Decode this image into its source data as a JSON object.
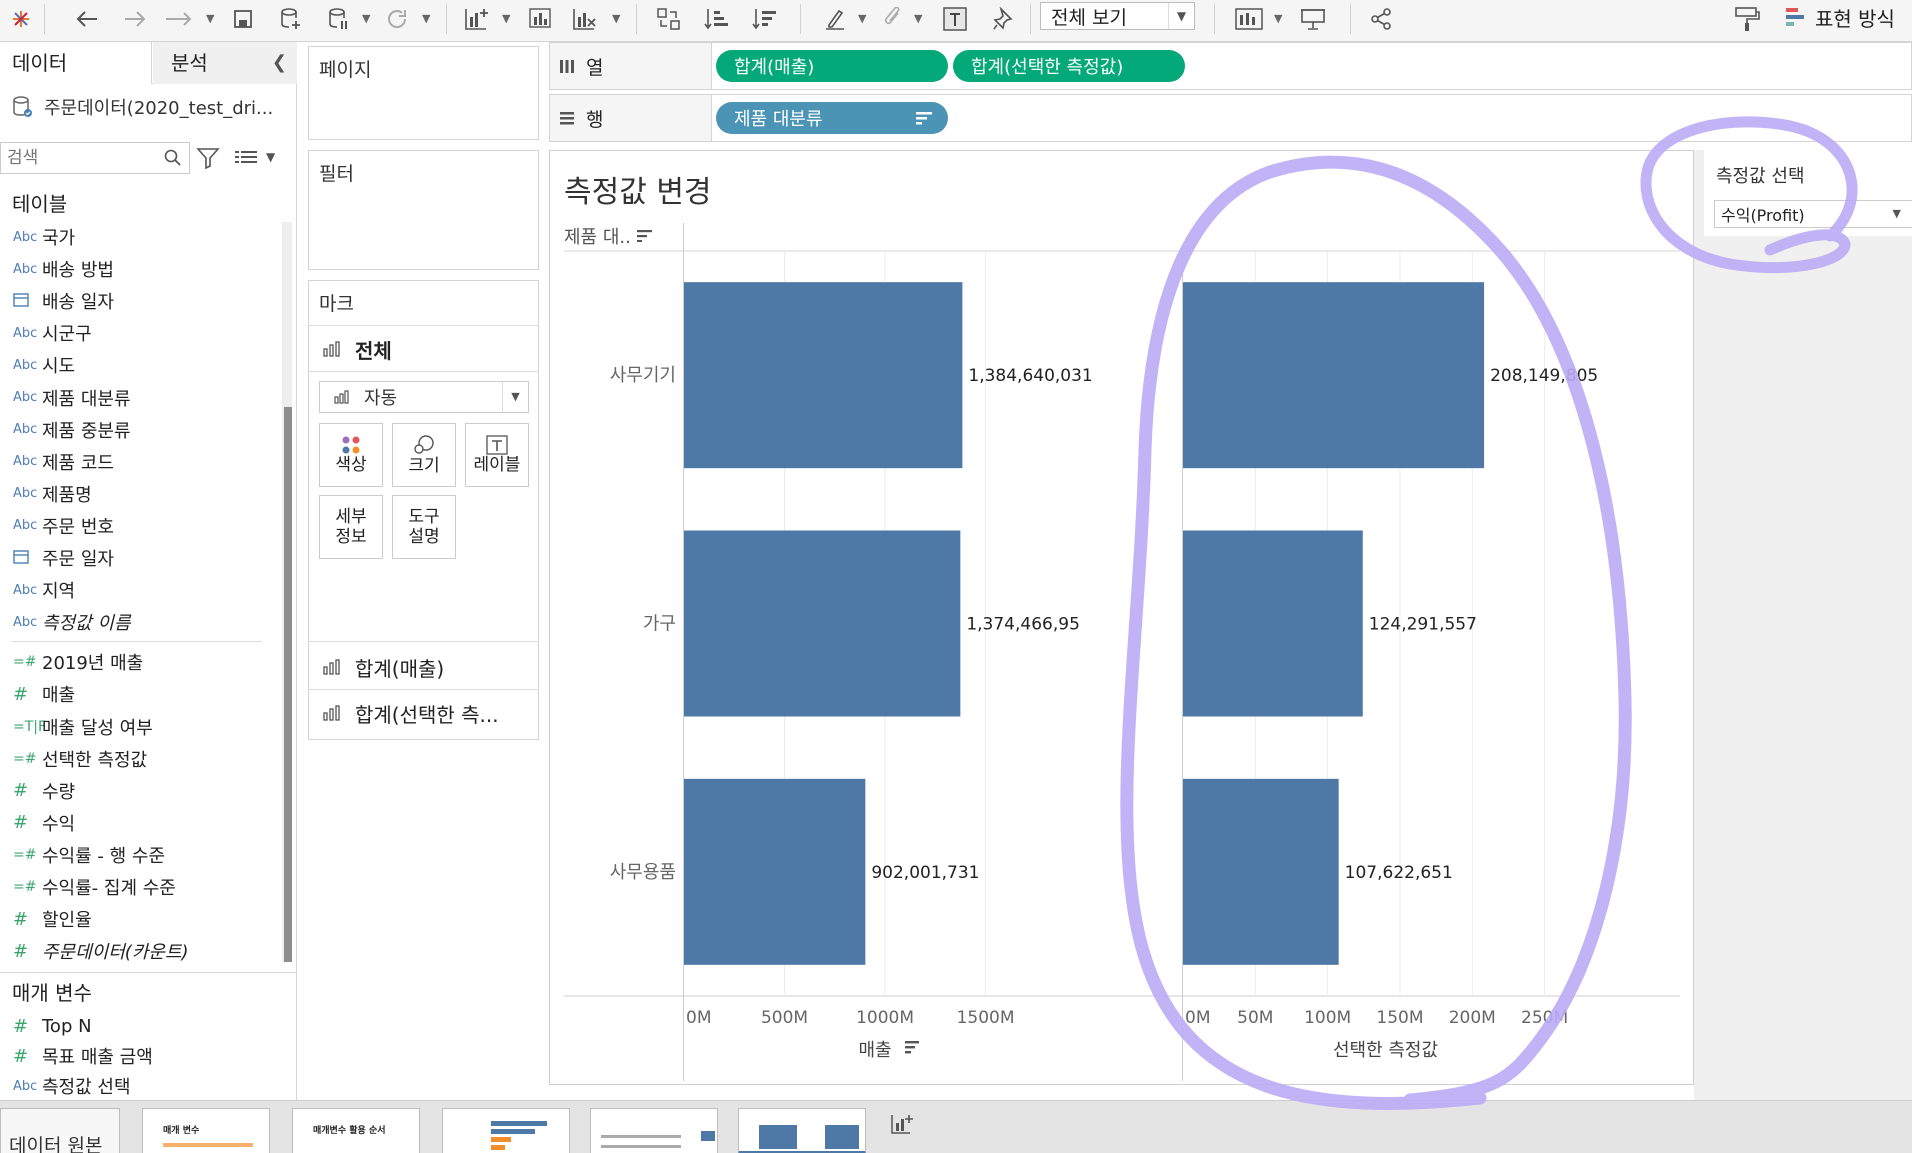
{
  "toolbar": {
    "view_select": "전체 보기",
    "show_me_label": "표현 방식"
  },
  "data_pane": {
    "tab_data": "데이터",
    "tab_analytics": "분석",
    "source_name": "주문데이터(2020_test_dri...",
    "search_placeholder": "검색",
    "tables_title": "테이블",
    "fields": [
      {
        "icon": "Abc",
        "name": "국가"
      },
      {
        "icon": "Abc",
        "name": "배송 방법"
      },
      {
        "icon": "calendar",
        "name": "배송 일자"
      },
      {
        "icon": "Abc",
        "name": "시군구"
      },
      {
        "icon": "Abc",
        "name": "시도"
      },
      {
        "icon": "Abc",
        "name": "제품 대분류"
      },
      {
        "icon": "Abc",
        "name": "제품 중분류"
      },
      {
        "icon": "Abc",
        "name": "제품 코드"
      },
      {
        "icon": "Abc",
        "name": "제품명"
      },
      {
        "icon": "Abc",
        "name": "주문 번호"
      },
      {
        "icon": "calendar",
        "name": "주문 일자"
      },
      {
        "icon": "Abc",
        "name": "지역"
      },
      {
        "icon": "Abc",
        "name": "측정값 이름"
      },
      {
        "icon": "=#",
        "name": "2019년 매출"
      },
      {
        "icon": "#",
        "name": "매출"
      },
      {
        "icon": "=T|F",
        "name": "매출 달성 여부"
      },
      {
        "icon": "=#",
        "name": "선택한 측정값"
      },
      {
        "icon": "#",
        "name": "수량"
      },
      {
        "icon": "#",
        "name": "수익"
      },
      {
        "icon": "=#",
        "name": "수익률 - 행 수준"
      },
      {
        "icon": "=#",
        "name": "수익률- 집계 수준"
      },
      {
        "icon": "#",
        "name": "할인율"
      },
      {
        "icon": "#",
        "name": "주문데이터(카운트)"
      }
    ],
    "params_title": "매개 변수",
    "params": [
      {
        "icon": "#",
        "name": "Top N"
      },
      {
        "icon": "#",
        "name": "목표 매출 금액"
      },
      {
        "icon": "Abc",
        "name": "측정값 선택"
      }
    ]
  },
  "pages_panel": {
    "title": "페이지"
  },
  "filters_panel": {
    "title": "필터"
  },
  "marks_panel": {
    "title": "마크",
    "all_label": "전체",
    "mark_type": "자동",
    "buttons": {
      "color": "색상",
      "size": "크기",
      "label": "레이블",
      "detail_1": "세부",
      "detail_2": "정보",
      "tooltip_1": "도구",
      "tooltip_2": "설명"
    },
    "measure_1": "합계(매출)",
    "measure_2": "합계(선택한 측..."
  },
  "shelves": {
    "columns_label": "열",
    "rows_label": "행",
    "column_pills": [
      "합계(매출)",
      "합계(선택한 측정값)"
    ],
    "row_pills": [
      "제품 대분류"
    ]
  },
  "sheet": {
    "title": "측정값 변경",
    "row_header": "제품 대.."
  },
  "parameter_card": {
    "title": "측정값 선택",
    "value": "수익(Profit)"
  },
  "bottom": {
    "data_source_tab": "데이터 원본",
    "sheet_tabs": [
      "매개 변수",
      "매개변수 활용 순서"
    ]
  },
  "colors": {
    "bar": "#4e79a7",
    "pill_green": "#03a979",
    "pill_blue": "#4b94b5",
    "annotation": "#b9acf5"
  },
  "chart_data": [
    {
      "type": "bar",
      "orientation": "horizontal",
      "categories": [
        "사무기기",
        "가구",
        "사무용품"
      ],
      "values": [
        1384640031,
        1374466950,
        902001731
      ],
      "value_labels": [
        "1,384,640,031",
        "1,374,466,95",
        "902,001,731"
      ],
      "xlabel": "매출",
      "ticks": [
        "0M",
        "500M",
        "1000M",
        "1500M"
      ],
      "xlim": [
        0,
        1900000000
      ]
    },
    {
      "type": "bar",
      "orientation": "horizontal",
      "categories": [
        "사무기기",
        "가구",
        "사무용품"
      ],
      "values": [
        208149805,
        124291557,
        107622651
      ],
      "value_labels": [
        "208,149,805",
        "124,291,557",
        "107,622,651"
      ],
      "xlabel": "선택한 측정값",
      "ticks": [
        "0M",
        "50M",
        "100M",
        "150M",
        "200M",
        "250M"
      ],
      "xlim": [
        0,
        280000000
      ]
    }
  ]
}
